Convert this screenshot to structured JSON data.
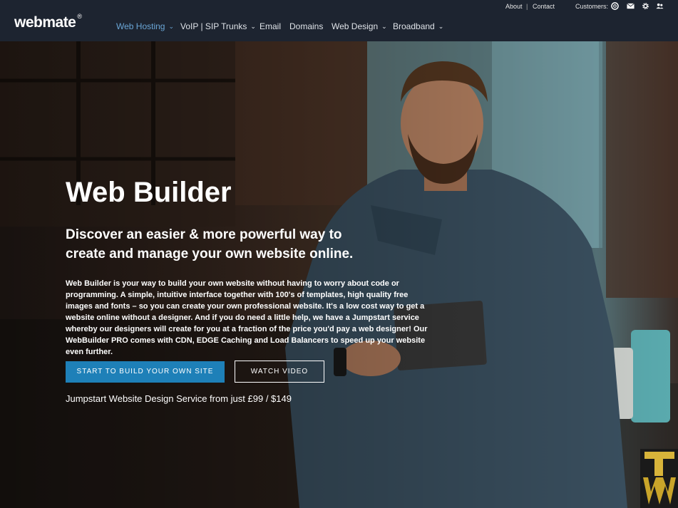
{
  "header": {
    "logo_text": "webmate",
    "logo_mark": "®",
    "util": {
      "about": "About",
      "separator": "|",
      "contact": "Contact",
      "customers": "Customers:"
    },
    "icons": [
      "support-icon",
      "email-icon",
      "gear-icon",
      "users-icon"
    ],
    "nav": [
      {
        "label": "Web Hosting",
        "chevron": "⌄",
        "active": true
      },
      {
        "label": "VoIP | SIP Trunks",
        "chevron": "⌄",
        "active": false
      },
      {
        "label": "Email",
        "chevron": "",
        "active": false
      },
      {
        "label": "Domains",
        "chevron": "",
        "active": false
      },
      {
        "label": "Web Design",
        "chevron": "⌄",
        "active": false
      },
      {
        "label": "Broadband",
        "chevron": "⌄",
        "active": false
      }
    ]
  },
  "hero": {
    "title": "Web Builder",
    "subtitle": "Discover an easier & more powerful way to create and manage your own website online.",
    "description": "Web Builder is your way to build your own website without having to worry about code or programming. A simple, intuitive interface together with 100's of templates, high quality free images and fonts – so you can create your own professional website. It's a low cost way to get a website online without a designer. And if you do need a little help, we have a Jumpstart service whereby our designers will create for you at a fraction of the price you'd pay a web designer! Our WebBuilder PRO comes with CDN, EDGE Caching and Load Balancers to speed up your website even further.",
    "primary_button": "START TO BUILD YOUR OWN SITE",
    "secondary_button": "WATCH VIDEO",
    "jumpstart": "Jumpstart Website Design Service from just £99 / $149"
  },
  "colors": {
    "header_bg": "#1d2430",
    "nav_active": "#6aa6d6",
    "primary_button": "#1e80b8",
    "badge": "#c9a52a"
  }
}
